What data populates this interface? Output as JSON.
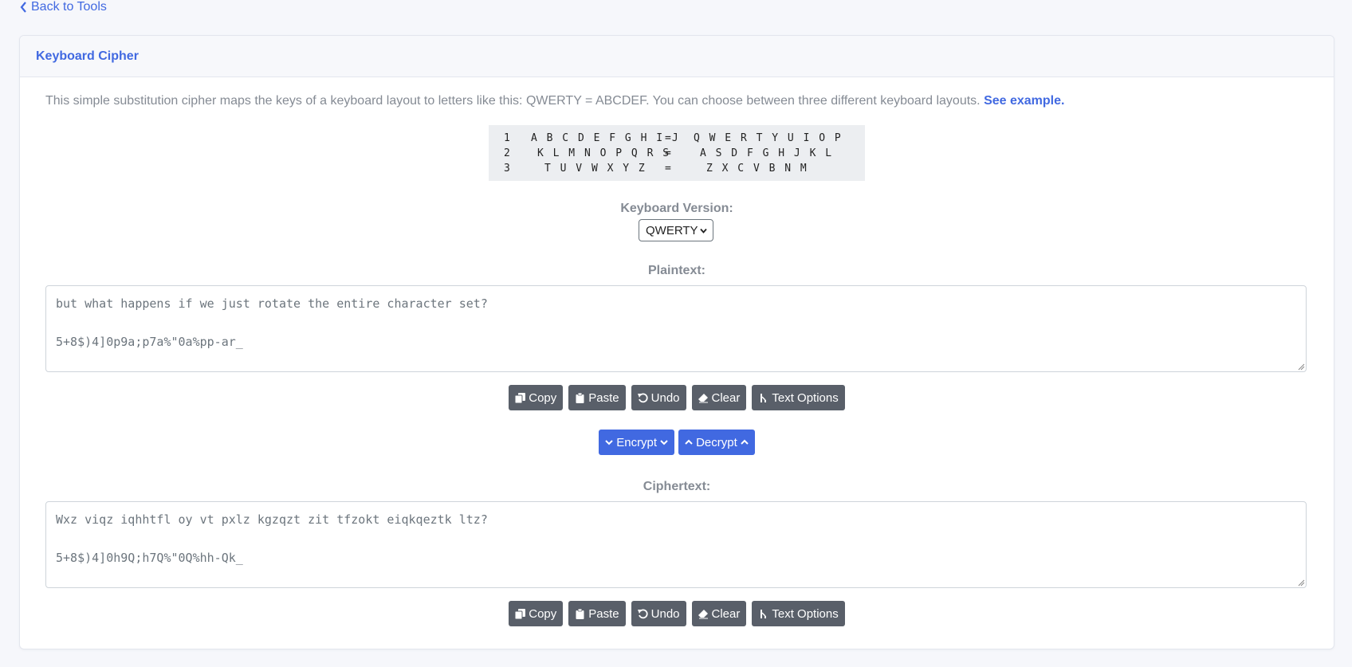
{
  "nav": {
    "back_label": "Back to Tools"
  },
  "card": {
    "title": "Keyboard Cipher"
  },
  "description": {
    "text": "This simple substitution cipher maps the keys of a keyboard layout to letters like this: QWERTY = ABCDEF. You can choose between three different keyboard layouts. ",
    "link_label": "See example."
  },
  "key_table": [
    {
      "num": "1",
      "letters": "A B C D E F G H I J",
      "eq": "=",
      "keys": "Q W E R T Y U I O P"
    },
    {
      "num": "2",
      "letters": "K L M N O P Q R S",
      "eq": "=",
      "keys": "A S D F G H J K L"
    },
    {
      "num": "3",
      "letters": "T U V W X Y Z",
      "eq": "=",
      "keys": "Z X C V B N M"
    }
  ],
  "keyboard": {
    "label": "Keyboard Version:",
    "selected": "QWERTY"
  },
  "plaintext": {
    "label": "Plaintext:",
    "value": "but what happens if we just rotate the entire character set?\n\n5+8$)4]0p9a;p7a%\"0a%pp-ar_"
  },
  "ciphertext": {
    "label": "Ciphertext:",
    "value": "Wxz viqz iqhhtfl oy vt pxlz kgzqzt zit tfzokt eiqkqeztk ltz?\n\n5+8$)4]0h9Q;h7Q%\"0Q%hh-Qk_"
  },
  "buttons": {
    "copy": "Copy",
    "paste": "Paste",
    "undo": "Undo",
    "clear": "Clear",
    "text_options": "Text Options",
    "encrypt": "Encrypt",
    "decrypt": "Decrypt"
  },
  "icons": {
    "back": "chevron-left-icon",
    "copy": "copy-icon",
    "paste": "clipboard-icon",
    "undo": "undo-icon",
    "clear": "eraser-icon",
    "text_options": "text-cursor-icon",
    "encrypt": "chevron-down-icon",
    "decrypt": "chevron-up-icon"
  },
  "colors": {
    "accent": "#4169e1",
    "button": "#595f69",
    "background": "#f6f7fb"
  }
}
